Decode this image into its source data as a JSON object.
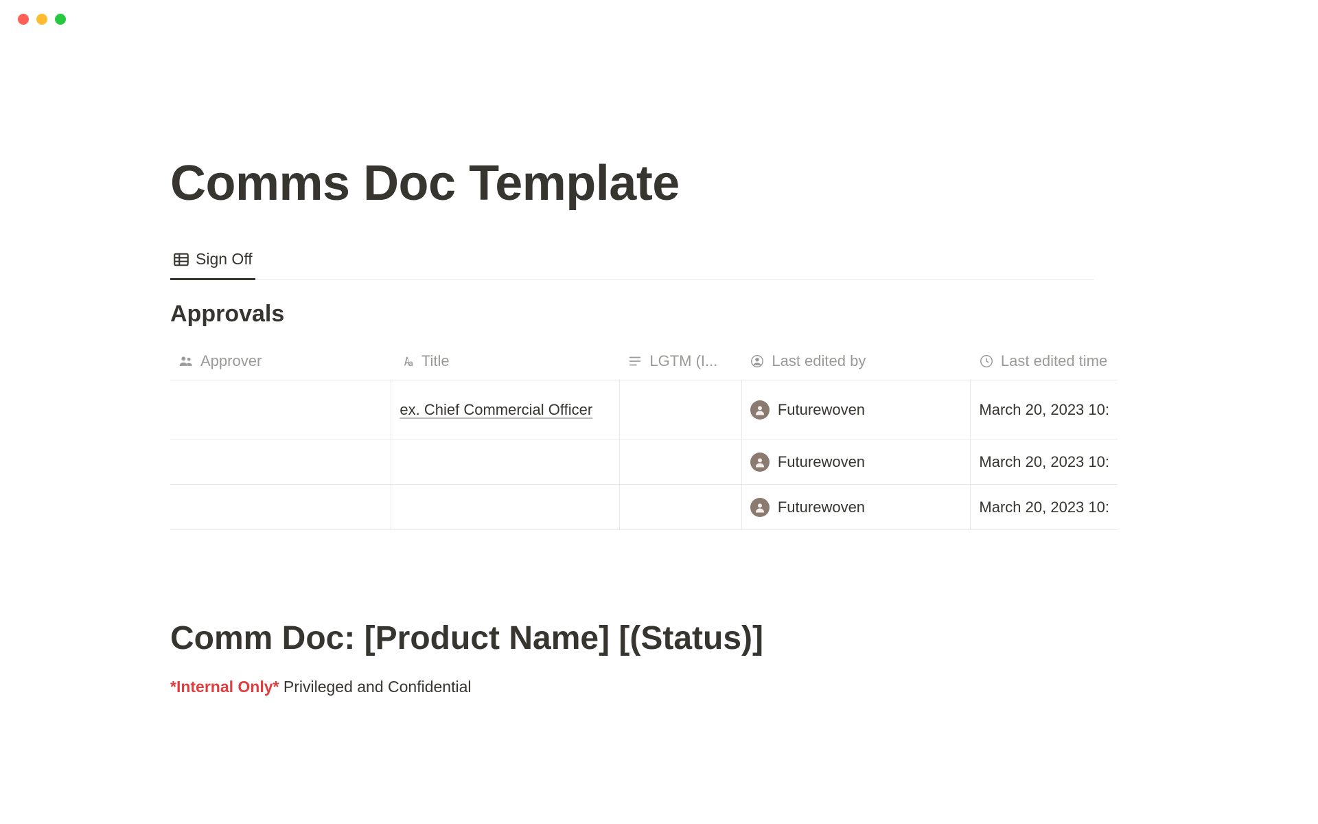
{
  "window": {},
  "page": {
    "title": "Comms Doc Template"
  },
  "tabs": {
    "signoff": "Sign Off"
  },
  "approvals": {
    "heading": "Approvals",
    "columns": {
      "approver": "Approver",
      "title": "Title",
      "lgtm": "LGTM (I...",
      "last_edited_by": "Last edited by",
      "last_edited_time": "Last edited time"
    },
    "rows": [
      {
        "approver": "",
        "title": "ex. Chief Commercial Officer",
        "lgtm": "",
        "last_edited_by": "Futurewoven",
        "last_edited_time": "March 20, 2023 10:"
      },
      {
        "approver": "",
        "title": "",
        "lgtm": "",
        "last_edited_by": "Futurewoven",
        "last_edited_time": "March 20, 2023 10:"
      },
      {
        "approver": "",
        "title": "",
        "lgtm": "",
        "last_edited_by": "Futurewoven",
        "last_edited_time": "March 20, 2023 10:"
      }
    ]
  },
  "doc": {
    "heading": "Comm Doc: [Product Name] [(Status)]",
    "internal": "*Internal Only*",
    "conf": " Privileged and Confidential"
  }
}
